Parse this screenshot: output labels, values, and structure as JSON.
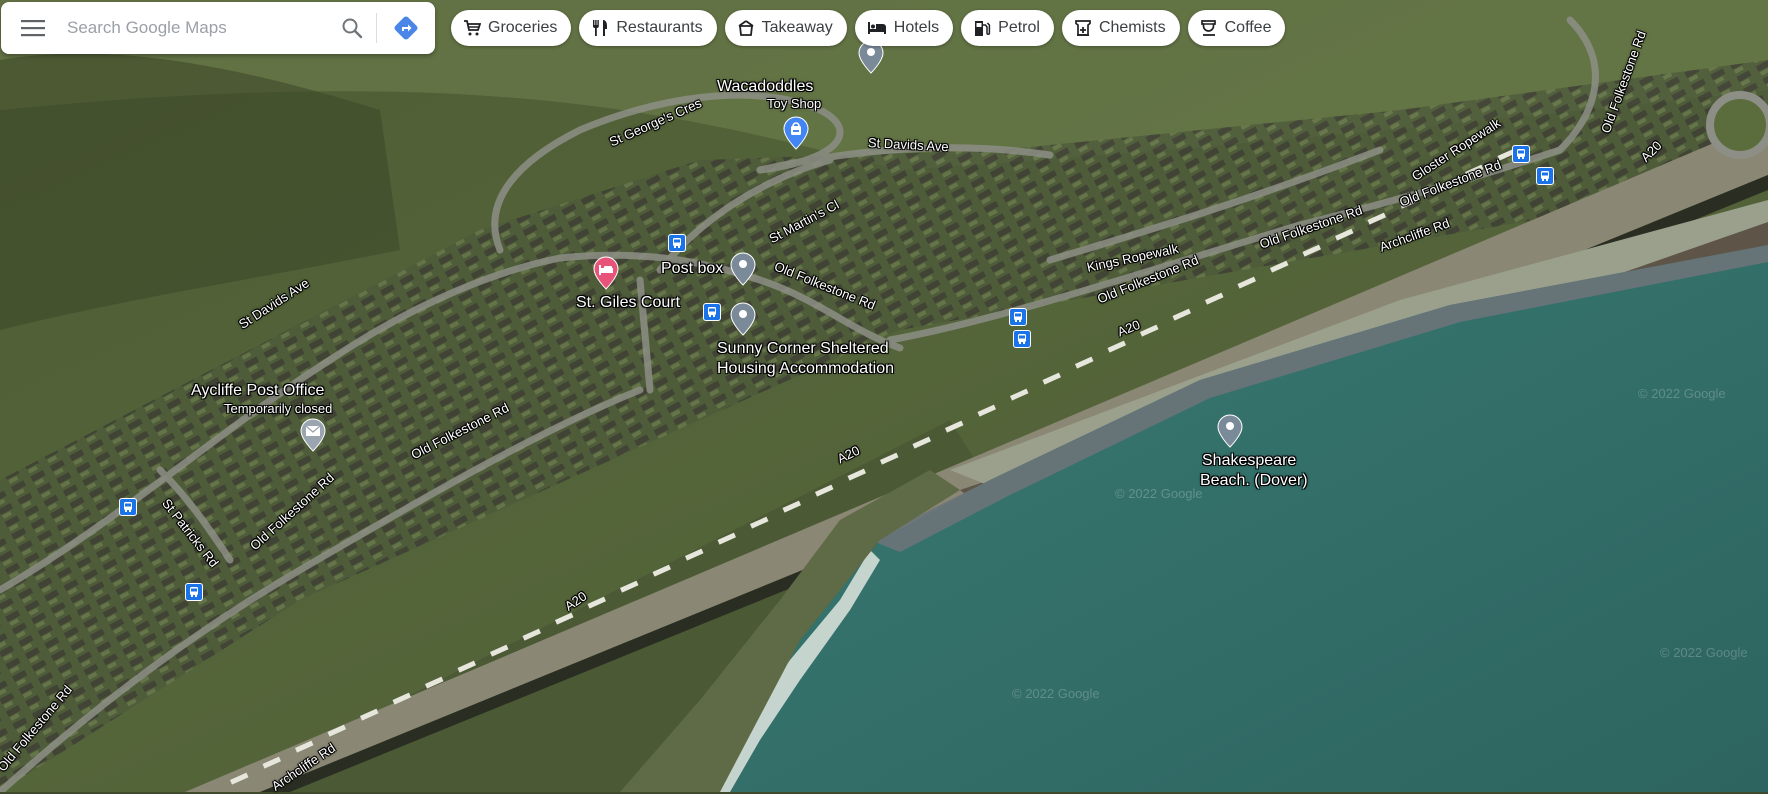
{
  "search": {
    "placeholder": "Search Google Maps",
    "menu_icon": "hamburger-menu-icon",
    "search_icon": "magnifier-icon",
    "directions_icon": "directions-icon",
    "directions_color": "#1a73e8"
  },
  "chips": [
    {
      "label": "Groceries",
      "icon": "shopping-cart-icon"
    },
    {
      "label": "Restaurants",
      "icon": "fork-knife-icon"
    },
    {
      "label": "Takeaway",
      "icon": "takeaway-bag-icon"
    },
    {
      "label": "Hotels",
      "icon": "bed-icon"
    },
    {
      "label": "Petrol",
      "icon": "fuel-pump-icon"
    },
    {
      "label": "Chemists",
      "icon": "pharmacy-icon"
    },
    {
      "label": "Coffee",
      "icon": "coffee-cup-icon"
    }
  ],
  "places": {
    "wacadoddles": {
      "name": "Wacadoddles",
      "category": "Toy Shop",
      "pin_color": "#4285f4"
    },
    "st_giles": {
      "name": "St. Giles Court",
      "pin_color": "#e8537a"
    },
    "post_box": {
      "name": "Post box",
      "pin_color": "#7b8a99"
    },
    "sunny_corner": {
      "line1": "Sunny Corner Sheltered",
      "line2": "Housing Accommodation",
      "pin_color": "#7b8a99"
    },
    "aycliffe_po": {
      "name": "Aycliffe Post Office",
      "status": "Temporarily closed",
      "pin_color": "#7b8a99"
    },
    "shakespeare": {
      "line1": "Shakespeare",
      "line2": "Beach. (Dover)",
      "pin_color": "#7b8a99"
    }
  },
  "roads": {
    "st_georges_cres": "St George's Cres",
    "st_davids_ave_1": "St Davids Ave",
    "st_davids_ave_2": "St Davids Ave",
    "st_martins_cl": "St Martin's Cl",
    "old_folkestone_1": "Old Folkestone Rd",
    "old_folkestone_2": "Old Folkestone Rd",
    "old_folkestone_3": "Old Folkestone Rd",
    "old_folkestone_4": "Old Folkestone Rd",
    "old_folkestone_5": "Old Folkestone Rd",
    "old_folkestone_6": "Old Folkestone Rd",
    "old_folkestone_7": "Old Folkestone Rd",
    "old_folkestone_8": "Old Folkestone Rd",
    "kings_ropewalk": "Kings Ropewalk",
    "gloster_ropewalk": "Gloster Ropewalk",
    "archcliffe_1": "Archcliffe Rd",
    "archcliffe_2": "Archcliffe Rd",
    "st_patricks": "St Patricks Rd",
    "a20_1": "A20",
    "a20_2": "A20",
    "a20_3": "A20",
    "a20_4": "A20"
  },
  "copyright": "© 2022 Google",
  "bus_stop_icon": "bus-stop-icon",
  "colors": {
    "sea": "#2e6a66",
    "land": "#4a5a36",
    "road": "#8d8f86"
  }
}
